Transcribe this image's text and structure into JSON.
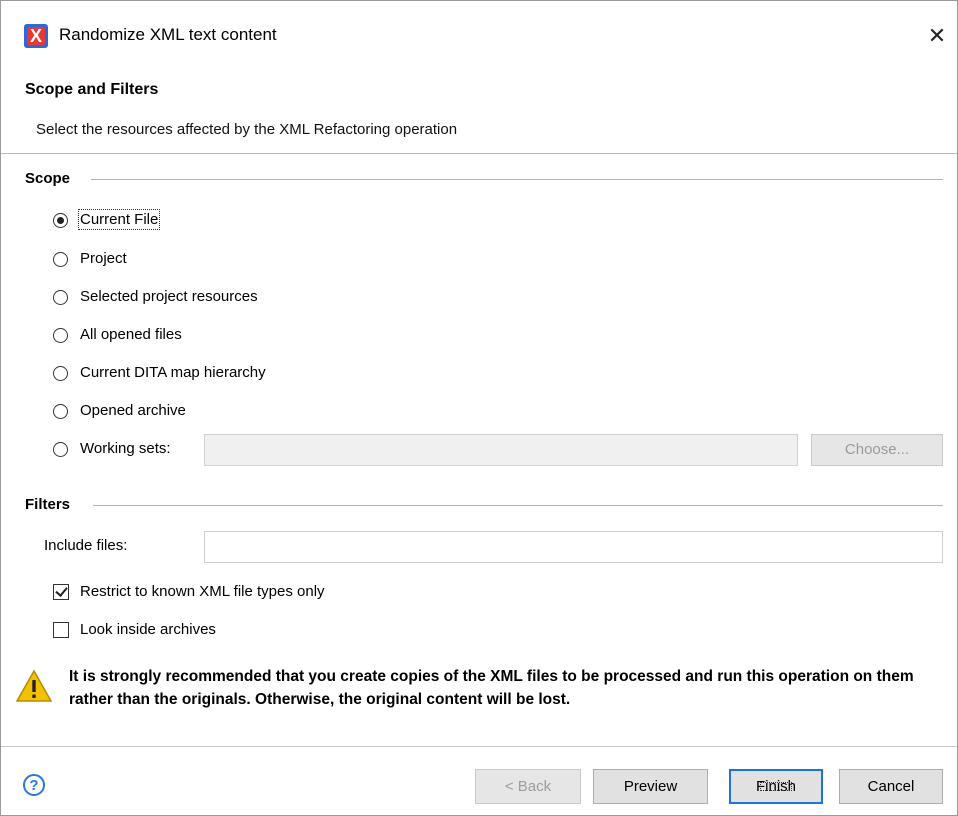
{
  "window": {
    "title": "Randomize XML text content",
    "close_glyph": "✕",
    "app_icon": "oxygen-x-icon"
  },
  "header": {
    "title": "Scope and Filters",
    "description": "Select the resources affected by the XML Refactoring operation"
  },
  "scope": {
    "label": "Scope",
    "options": [
      {
        "label": "Current File",
        "checked": true
      },
      {
        "label": "Project",
        "checked": false
      },
      {
        "label": "Selected project resources",
        "checked": false
      },
      {
        "label": "All opened files",
        "checked": false
      },
      {
        "label": "Current DITA map hierarchy",
        "checked": false
      },
      {
        "label": "Opened archive",
        "checked": false
      },
      {
        "label": "Working sets:",
        "checked": false
      }
    ],
    "working_sets_value": "",
    "choose_button": "Choose..."
  },
  "filters": {
    "label": "Filters",
    "include_files_label": "Include files:",
    "include_files_value": "",
    "restrict_label": "Restrict to known XML file types only",
    "restrict_checked": true,
    "look_inside_label": "Look inside archives",
    "look_inside_checked": false
  },
  "warning": {
    "icon": "warning-icon",
    "text": "It is strongly recommended that you create copies of the XML files to be processed and run this operation on them rather than the originals. Otherwise, the original content will be lost."
  },
  "buttons": {
    "help_icon": "?",
    "back": "< Back",
    "preview": "Preview",
    "finish": "Finish",
    "cancel": "Cancel"
  },
  "colors": {
    "accent": "#1e74d3",
    "help": "#2b78d8",
    "warning": "#f2c200"
  }
}
